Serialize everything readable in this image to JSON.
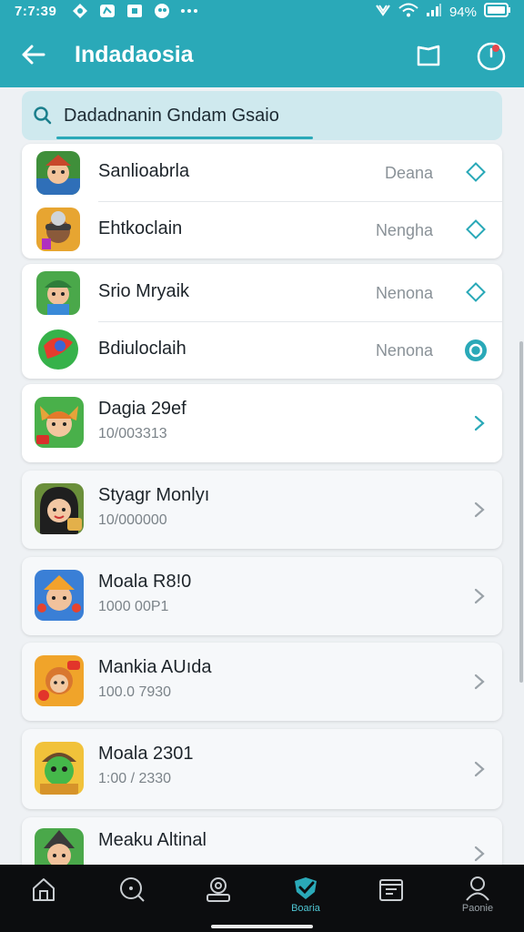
{
  "status_bar": {
    "time": "7:7:39",
    "battery_text": "94%"
  },
  "app_bar": {
    "title": "Indadaosia"
  },
  "search": {
    "value": "Dadadnanin Gndam Gsaio"
  },
  "groups": [
    {
      "items": [
        {
          "name": "Sanlioabrla",
          "tag": "Deana",
          "control": "diamond-outline"
        },
        {
          "name": "Ehtkoclain",
          "tag": "Nengha",
          "control": "diamond-outline"
        }
      ]
    },
    {
      "items": [
        {
          "name": "Srio Mryaik",
          "tag": "Nenona",
          "control": "diamond-outline"
        },
        {
          "name": "Bdiuloclaih",
          "tag": "Nenona",
          "control": "radio-selected"
        }
      ]
    }
  ],
  "list": [
    {
      "name": "Dagia 29ef",
      "sub": "10/003313"
    },
    {
      "name": "Styagr Monlyı",
      "sub": "10/000000"
    },
    {
      "name": "Moala R8!0",
      "sub": "1000 00P1"
    },
    {
      "name": "Mankia AUıda",
      "sub": "100.0 7930"
    },
    {
      "name": "Moala 2301",
      "sub": "1:00 / 2330"
    },
    {
      "name": "Meaku  Altinal",
      "sub": ""
    }
  ],
  "bottom_nav": [
    {
      "icon": "home-icon",
      "label": ""
    },
    {
      "icon": "search-icon",
      "label": ""
    },
    {
      "icon": "profile-badge-icon",
      "label": ""
    },
    {
      "icon": "shield-check-icon",
      "label": "Boaria",
      "active": true
    },
    {
      "icon": "folder-icon",
      "label": ""
    },
    {
      "icon": "person-icon",
      "label": "Paonie"
    }
  ],
  "colors": {
    "accent": "#2aa9b8",
    "header": "#2aa9b8",
    "active_nav": "#4fc6d3"
  }
}
